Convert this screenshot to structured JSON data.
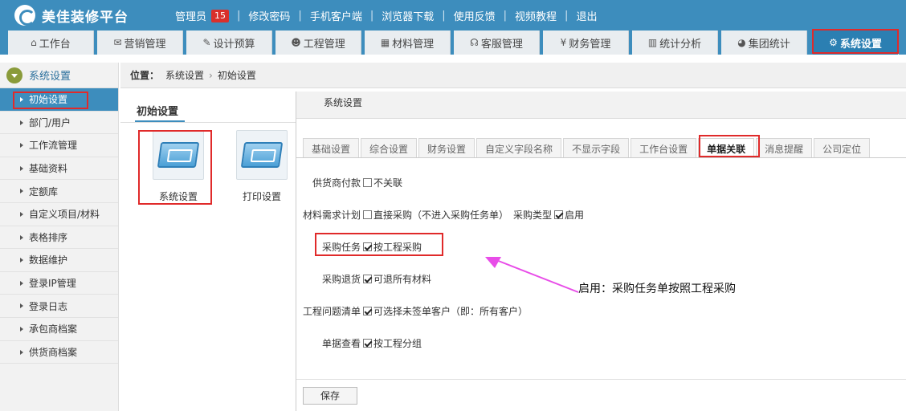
{
  "app": {
    "title": "美佳装修平台"
  },
  "topbar": {
    "admin_label": "管理员",
    "admin_badge": "15",
    "links": [
      "修改密码",
      "手机客户端",
      "浏览器下载",
      "使用反馈",
      "视频教程",
      "退出"
    ]
  },
  "nav": {
    "tabs": [
      {
        "label": "工作台",
        "icon": "home-icon",
        "glyph": "⌂"
      },
      {
        "label": "营销管理",
        "icon": "chat-icon",
        "glyph": "✉"
      },
      {
        "label": "设计预算",
        "icon": "edit-icon",
        "glyph": "✎"
      },
      {
        "label": "工程管理",
        "icon": "users-icon",
        "glyph": "☻"
      },
      {
        "label": "材料管理",
        "icon": "grid-icon",
        "glyph": "▦"
      },
      {
        "label": "客服管理",
        "icon": "headset-icon",
        "glyph": "☊"
      },
      {
        "label": "财务管理",
        "icon": "yen-icon",
        "glyph": "¥"
      },
      {
        "label": "统计分析",
        "icon": "bar-chart-icon",
        "glyph": "▥"
      },
      {
        "label": "集团统计",
        "icon": "pie-chart-icon",
        "glyph": "◕"
      },
      {
        "label": "系统设置",
        "icon": "gear-icon",
        "glyph": "⚙"
      }
    ],
    "active_index": 9
  },
  "sidebar": {
    "header": "系统设置",
    "items": [
      "初始设置",
      "部门/用户",
      "工作流管理",
      "基础资料",
      "定额库",
      "自定义项目/材料",
      "表格排序",
      "数据维护",
      "登录IP管理",
      "登录日志",
      "承包商档案",
      "供货商档案"
    ],
    "active_index": 0
  },
  "breadcrumb": {
    "label": "位置：",
    "parts": [
      "系统设置",
      "初始设置"
    ]
  },
  "middle": {
    "title": "初始设置",
    "tiles": [
      "系统设置",
      "打印设置"
    ]
  },
  "panel": {
    "title": "系统设置",
    "tabs": [
      "基础设置",
      "综合设置",
      "财务设置",
      "自定义字段名称",
      "不显示字段",
      "工作台设置",
      "单据关联",
      "消息提醒",
      "公司定位"
    ],
    "active_tab": 6,
    "rows": [
      {
        "label": "供货商付款",
        "options": [
          {
            "text": "不关联",
            "checked": false
          }
        ]
      },
      {
        "label": "材料需求计划",
        "options": [
          {
            "text": "直接采购（不进入采购任务单）",
            "checked": false
          }
        ],
        "extra_label": "采购类型",
        "extra_options": [
          {
            "text": "启用",
            "checked": true
          }
        ]
      },
      {
        "label": "采购任务",
        "options": [
          {
            "text": "按工程采购",
            "checked": true
          }
        ]
      },
      {
        "label": "采购退货",
        "options": [
          {
            "text": "可退所有材料",
            "checked": true
          }
        ]
      },
      {
        "label": "工程问题清单",
        "options": [
          {
            "text": "可选择未签单客户（即：所有客户）",
            "checked": true
          }
        ]
      },
      {
        "label": "单据查看",
        "options": [
          {
            "text": "按工程分组",
            "checked": true
          }
        ]
      }
    ],
    "save_label": "保存"
  },
  "annotation": {
    "text": "启用：采购任务单按照工程采购",
    "arrow_color": "#e84de8",
    "box_color": "#e02a2a"
  }
}
